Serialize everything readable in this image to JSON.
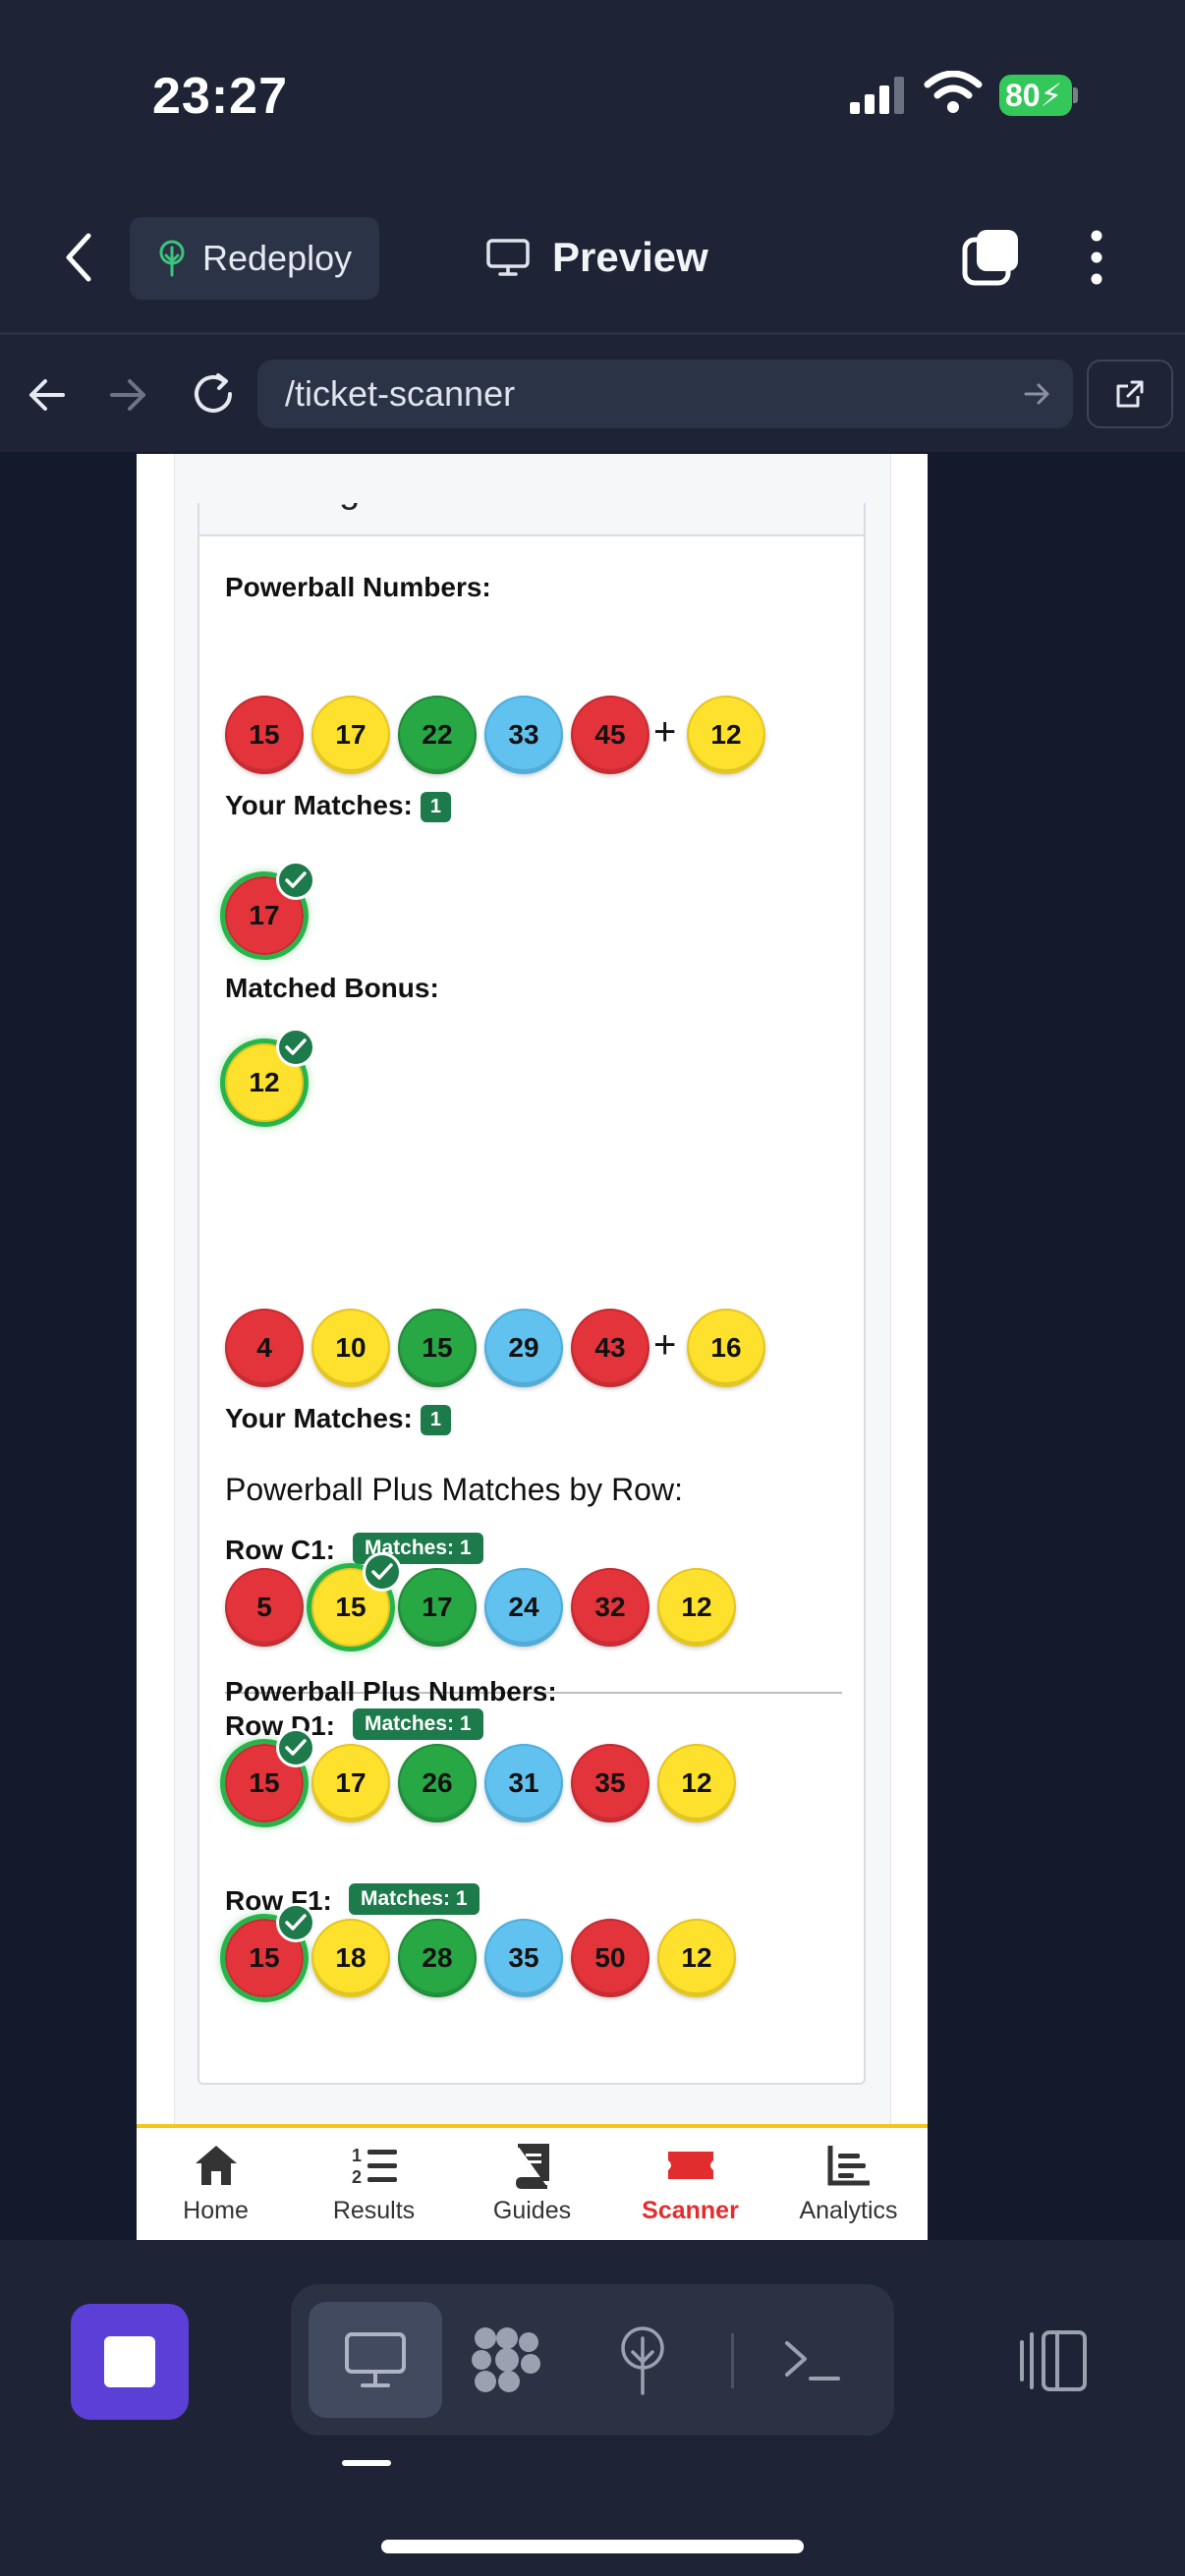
{
  "status_bar": {
    "time": "23:27",
    "battery": "80"
  },
  "top_bar": {
    "redeploy_label": "Redeploy",
    "preview_label": "Preview"
  },
  "url_bar": {
    "path": "/ticket-scanner"
  },
  "card": {
    "header": "Winning Numbers",
    "powerball": {
      "title": "Powerball Numbers:",
      "numbers": [
        "15",
        "17",
        "22",
        "33",
        "45"
      ],
      "plus": "+",
      "bonus": "12",
      "your_matches_label": "Your Matches:",
      "your_matches_count": "1",
      "matched_numbers": [
        "17"
      ],
      "matched_bonus_label": "Matched Bonus:",
      "matched_bonus": "12"
    },
    "powerball_plus": {
      "title": "Powerball Plus Numbers:",
      "numbers": [
        "4",
        "10",
        "15",
        "29",
        "43"
      ],
      "plus": "+",
      "bonus": "16",
      "your_matches_label": "Your Matches:",
      "your_matches_count": "1",
      "by_row_title": "Powerball Plus Matches by Row:",
      "rows": [
        {
          "label": "Row C1:",
          "badge": "Matches: 1",
          "numbers": [
            "5",
            "15",
            "17",
            "24",
            "32",
            "12"
          ]
        },
        {
          "label": "Row D1:",
          "badge": "Matches: 1",
          "numbers": [
            "15",
            "17",
            "26",
            "31",
            "35",
            "12"
          ]
        },
        {
          "label": "Row F1:",
          "badge": "Matches: 1",
          "numbers": [
            "15",
            "18",
            "28",
            "35",
            "50",
            "12"
          ]
        }
      ]
    }
  },
  "bottom_nav": {
    "items": [
      {
        "label": "Home"
      },
      {
        "label": "Results"
      },
      {
        "label": "Guides"
      },
      {
        "label": "Scanner"
      },
      {
        "label": "Analytics"
      }
    ],
    "active": "Scanner"
  },
  "colors": {
    "ball_red": "#e3343c",
    "ball_yellow": "#fde12d",
    "ball_green": "#28a745",
    "ball_blue": "#62c2ef",
    "match_badge": "#1d7a4a",
    "accent_active": "#e22d2f",
    "nav_border": "#f5c518",
    "run_button": "#5b3fd6"
  },
  "icons": {
    "status": [
      "signal-icon",
      "wifi-icon",
      "battery-icon"
    ],
    "toolbar": [
      "back-chevron-icon",
      "tree-icon",
      "monitor-icon",
      "tabs-icon",
      "kebab-icon"
    ],
    "url": [
      "arrow-left-icon",
      "arrow-right-icon",
      "reload-icon",
      "go-arrow-icon",
      "external-link-icon"
    ],
    "ide": [
      "stop-icon",
      "monitor-icon",
      "apps-grid-icon",
      "deploy-icon",
      "terminal-icon",
      "side-panel-icon"
    ]
  }
}
